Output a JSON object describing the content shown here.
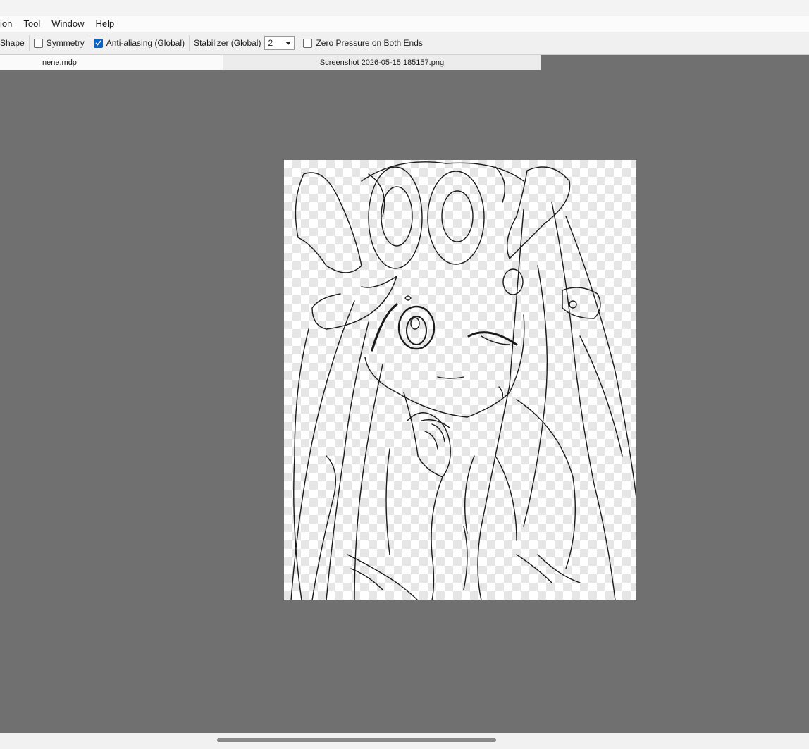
{
  "menubar": {
    "items": [
      "ion",
      "Tool",
      "Window",
      "Help"
    ]
  },
  "toolbar": {
    "shape_label": "Shape",
    "symmetry": {
      "label": "Symmetry",
      "checked": false
    },
    "antialias": {
      "label": "Anti-aliasing (Global)",
      "checked": true
    },
    "stabilizer": {
      "label": "Stabilizer (Global)",
      "value": "2"
    },
    "zero_pressure": {
      "label": "Zero Pressure on Both Ends",
      "checked": false
    }
  },
  "tabs": [
    {
      "label": "nene.mdp",
      "active": true
    },
    {
      "label": "Screenshot 2026-05-15 185157.png",
      "active": false
    }
  ],
  "colors": {
    "workspace": "#707070",
    "accent": "#0a64c8",
    "ink": "#1a1a1a"
  },
  "canvas": {
    "content": "line-art-sketch"
  }
}
